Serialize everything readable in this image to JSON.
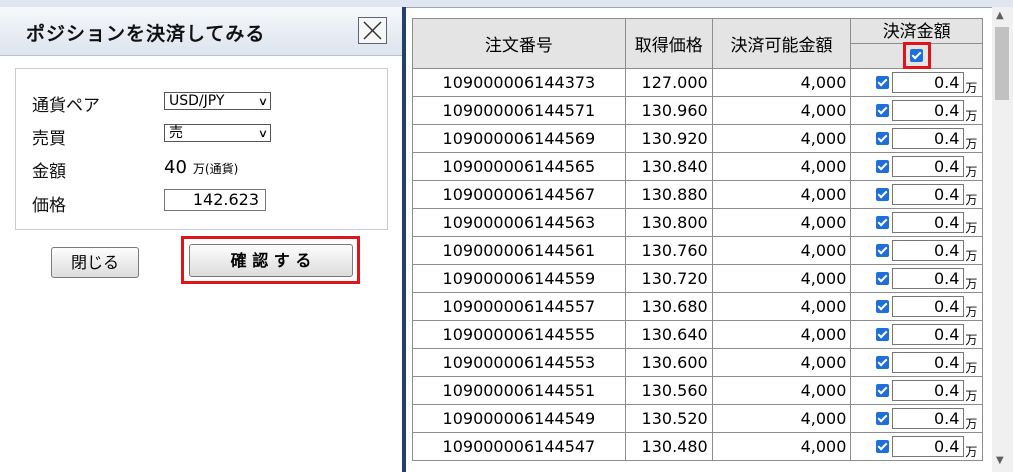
{
  "dialog": {
    "title": "ポジションを決済してみる",
    "close_symbol": "✕",
    "pair_label": "通貨ペア",
    "pair_value": "USD/JPY",
    "side_label": "売買",
    "side_value": "売",
    "amount_label": "金額",
    "amount_value": "40",
    "amount_unit": "万(通貨)",
    "price_label": "価格",
    "price_value": "142.623",
    "close_button": "閉じる",
    "confirm_button": "確 認 す る"
  },
  "grid": {
    "headers": [
      "注文番号",
      "取得価格",
      "決済可能金額",
      "決済金額"
    ],
    "unit": "万",
    "rows": [
      {
        "order": "109000006144373",
        "price": "127.000",
        "available": "4,000",
        "settle": "0.4"
      },
      {
        "order": "109000006144571",
        "price": "130.960",
        "available": "4,000",
        "settle": "0.4"
      },
      {
        "order": "109000006144569",
        "price": "130.920",
        "available": "4,000",
        "settle": "0.4"
      },
      {
        "order": "109000006144565",
        "price": "130.840",
        "available": "4,000",
        "settle": "0.4"
      },
      {
        "order": "109000006144567",
        "price": "130.880",
        "available": "4,000",
        "settle": "0.4"
      },
      {
        "order": "109000006144563",
        "price": "130.800",
        "available": "4,000",
        "settle": "0.4"
      },
      {
        "order": "109000006144561",
        "price": "130.760",
        "available": "4,000",
        "settle": "0.4"
      },
      {
        "order": "109000006144559",
        "price": "130.720",
        "available": "4,000",
        "settle": "0.4"
      },
      {
        "order": "109000006144557",
        "price": "130.680",
        "available": "4,000",
        "settle": "0.4"
      },
      {
        "order": "109000006144555",
        "price": "130.640",
        "available": "4,000",
        "settle": "0.4"
      },
      {
        "order": "109000006144553",
        "price": "130.600",
        "available": "4,000",
        "settle": "0.4"
      },
      {
        "order": "109000006144551",
        "price": "130.560",
        "available": "4,000",
        "settle": "0.4"
      },
      {
        "order": "109000006144549",
        "price": "130.520",
        "available": "4,000",
        "settle": "0.4"
      },
      {
        "order": "109000006144547",
        "price": "130.480",
        "available": "4,000",
        "settle": "0.4"
      }
    ]
  },
  "colors": {
    "highlight": "#e0141b",
    "checkbox": "#1e6fd9",
    "splitter": "#24416e"
  }
}
